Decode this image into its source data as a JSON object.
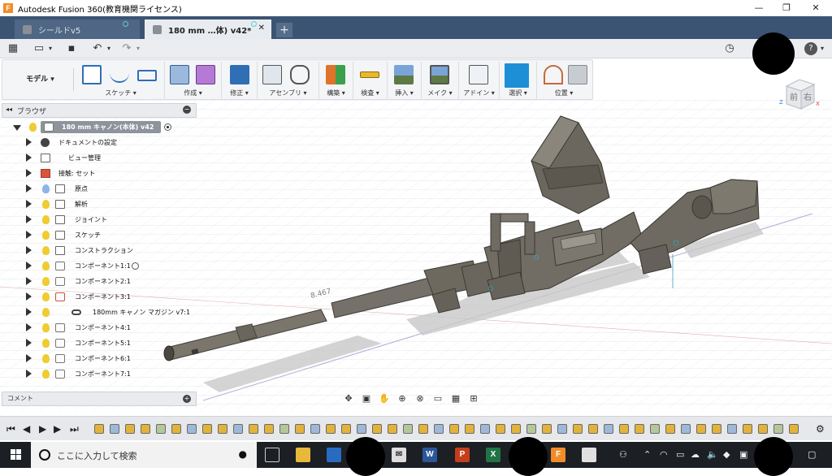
{
  "window": {
    "title": "Autodesk Fusion 360(教育機関ライセンス)",
    "app_icon": "F",
    "minimize": "—",
    "maximize": "❐",
    "close": "✕"
  },
  "tabs": [
    {
      "label": "シールドv5",
      "active": false
    },
    {
      "label": "180 mm …体) v42*",
      "active": true
    }
  ],
  "tab_add": "+",
  "tab_close": "✕",
  "toolbar": {
    "grid_icon": "▦",
    "file_icon": "▭",
    "save_icon": "▪",
    "undo_icon": "↶",
    "redo_icon": "↷",
    "history_icon": "◷",
    "help_icon": "?"
  },
  "ribbon": {
    "workspace": "モデル",
    "groups": [
      {
        "label": "スケッチ"
      },
      {
        "label": "作成"
      },
      {
        "label": "修正"
      },
      {
        "label": "アセンブリ"
      },
      {
        "label": "構築"
      },
      {
        "label": "検査"
      },
      {
        "label": "挿入"
      },
      {
        "label": "メイク"
      },
      {
        "label": "アドイン"
      },
      {
        "label": "選択"
      },
      {
        "label": "位置"
      }
    ]
  },
  "browser": {
    "title": "ブラウザ",
    "collapse": "◂◂",
    "close": "●",
    "root": "180 mm キャノン(本体) v42",
    "items": [
      {
        "label": "ドキュメントの設定",
        "icon": "gear-icon",
        "bulb": false
      },
      {
        "label": "ビュー管理",
        "icon": "folder-icon",
        "bulb": false
      },
      {
        "label": "接触: セット",
        "icon": "joint-icon",
        "bulb": false
      },
      {
        "label": "原点",
        "icon": "folder-icon",
        "bulb": "blue"
      },
      {
        "label": "解析",
        "icon": "folder-icon",
        "bulb": "yellow"
      },
      {
        "label": "ジョイント",
        "icon": "folder-icon",
        "bulb": "yellow"
      },
      {
        "label": "スケッチ",
        "icon": "folder-icon",
        "bulb": "yellow"
      },
      {
        "label": "コンストラクション",
        "icon": "folder-icon",
        "bulb": "yellow"
      },
      {
        "label": "コンポーネント1:1",
        "icon": "component-icon",
        "bulb": "yellow",
        "radio": true
      },
      {
        "label": "コンポーネント2:1",
        "icon": "component-icon",
        "bulb": "yellow"
      },
      {
        "label": "コンポーネント3:1",
        "icon": "component-icon",
        "bulb": "yellow"
      },
      {
        "label": "180mm キャノン マガジン v7:1",
        "icon": "link-icon",
        "bulb": "yellow"
      },
      {
        "label": "コンポーネント4:1",
        "icon": "component-icon",
        "bulb": "yellow"
      },
      {
        "label": "コンポーネント5:1",
        "icon": "component-icon",
        "bulb": "yellow"
      },
      {
        "label": "コンポーネント6:1",
        "icon": "component-icon",
        "bulb": "yellow"
      },
      {
        "label": "コンポーネント7:1",
        "icon": "component-icon",
        "bulb": "yellow"
      }
    ]
  },
  "comments": {
    "label": "コメント",
    "add": "+"
  },
  "viewport": {
    "dimension_label": "8.467"
  },
  "viewcube": {
    "front": "前",
    "right": "右",
    "z_axis": "Z",
    "x_axis": "X"
  },
  "taskbar": {
    "search_placeholder": "ここに入力して検索",
    "mic": "🎤"
  },
  "colors": {
    "tab_bar": "#3c5473",
    "accent_selected": "#1d8fd6",
    "model": "#6e6a60"
  }
}
